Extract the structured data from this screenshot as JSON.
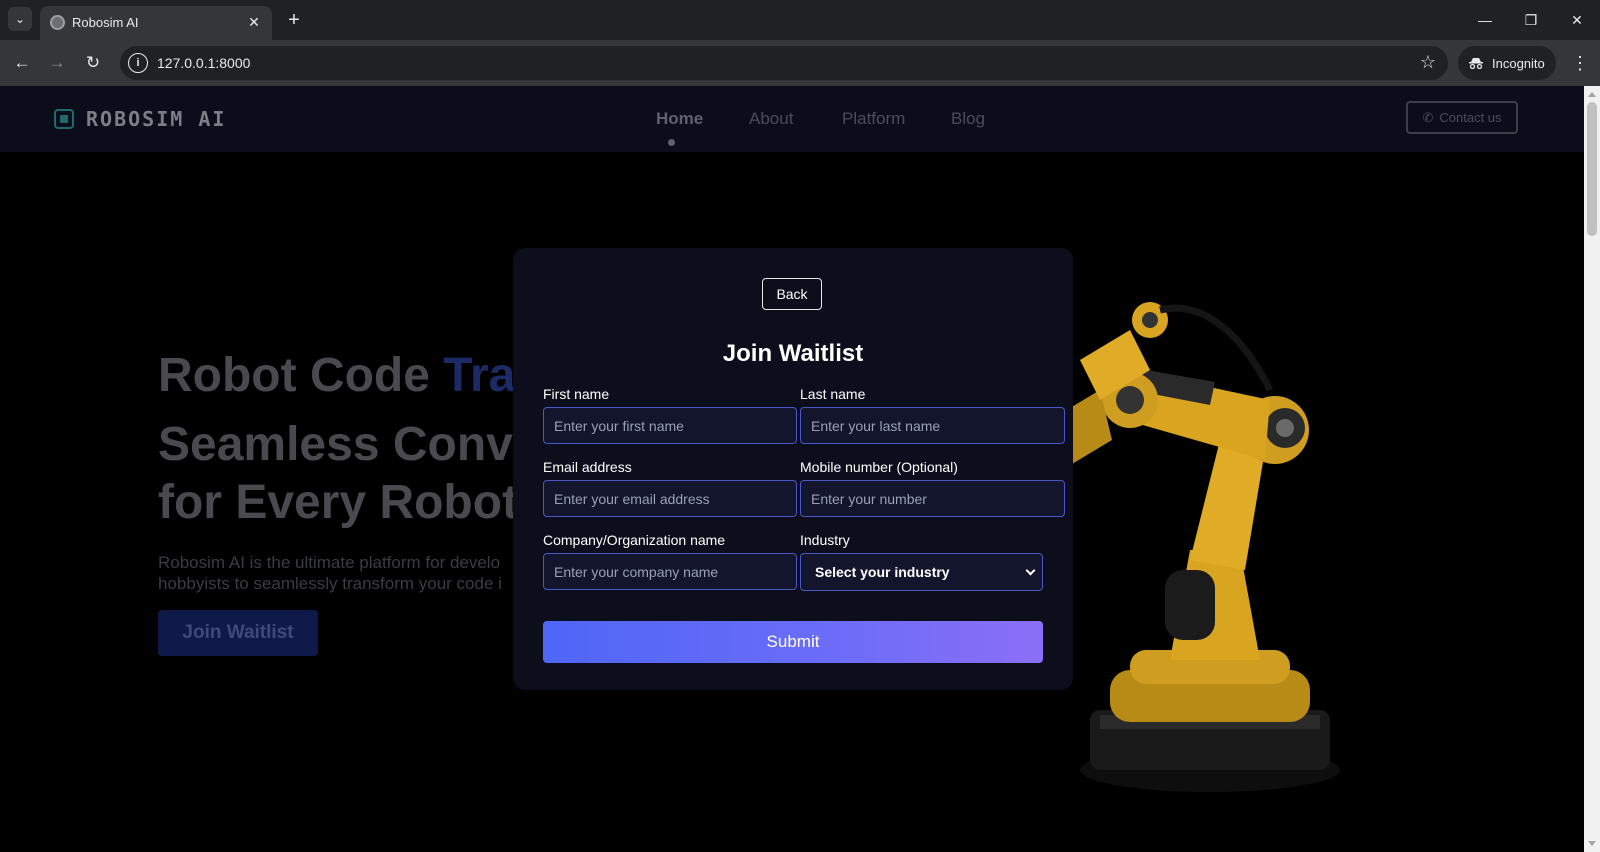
{
  "browser": {
    "tab_title": "Robosim AI",
    "url": "127.0.0.1:8000",
    "incognito_label": "Incognito"
  },
  "site": {
    "logo_text": "ROBOSIM AI",
    "nav": [
      {
        "label": "Home",
        "active": true
      },
      {
        "label": "About",
        "active": false
      },
      {
        "label": "Platform",
        "active": false
      },
      {
        "label": "Blog",
        "active": false
      }
    ],
    "contact_label": "Contact us"
  },
  "hero": {
    "line1_plain": "Robot Code ",
    "line1_accent": "Tra",
    "line2a": "Seamless Conv",
    "line2b": "for Every Robot",
    "desc_line1": "Robosim AI is the ultimate platform for develo",
    "desc_line2": "hobbyists to seamlessly transform your code i",
    "cta_label": "Join Waitlist"
  },
  "modal": {
    "back_label": "Back",
    "title": "Join Waitlist",
    "first_name": {
      "label": "First name",
      "placeholder": "Enter your first name"
    },
    "last_name": {
      "label": "Last name",
      "placeholder": "Enter your last name"
    },
    "email": {
      "label": "Email address",
      "placeholder": "Enter your email address"
    },
    "mobile": {
      "label": "Mobile number (Optional)",
      "placeholder": "Enter your number"
    },
    "company": {
      "label": "Company/Organization name",
      "placeholder": "Enter your company name"
    },
    "industry": {
      "label": "Industry",
      "selected": "Select your industry"
    },
    "submit_label": "Submit"
  },
  "colors": {
    "accent": "#4f66f6",
    "modal_bg": "#0d0e1c",
    "input_border": "#4b56c8",
    "robot": "#d9a521"
  }
}
